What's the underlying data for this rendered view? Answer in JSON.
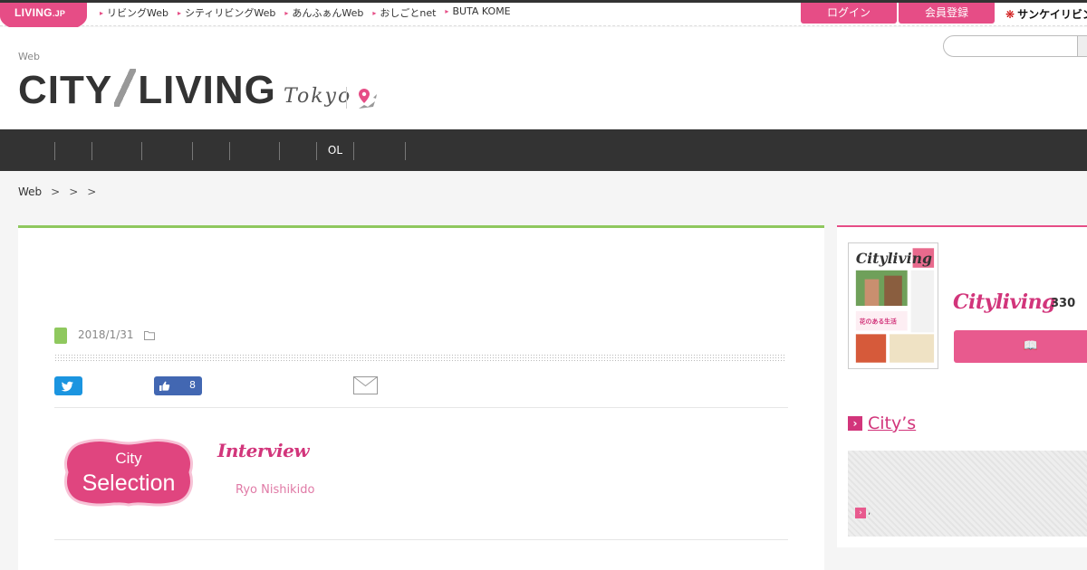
{
  "topbar": {
    "brand": "LIVING",
    "brand_suffix": ".JP",
    "links": [
      "リビングWeb",
      "シティリビングWeb",
      "あんふぁんWeb",
      "おしごとnet",
      "BUTA KOME"
    ],
    "login_label": "ログイン",
    "register_label": "会員登録",
    "sankei_label": "サンケイリビン"
  },
  "header": {
    "web_label": "Web",
    "logo_left": "CITY",
    "logo_right": "LIVING",
    "city": "Tokyo",
    "search_placeholder": ""
  },
  "nav": {
    "items": [
      "",
      "",
      "",
      "",
      "",
      "",
      "",
      "OL",
      ""
    ]
  },
  "breadcrumb": {
    "items": [
      "Web",
      ">",
      ">",
      ">"
    ]
  },
  "article": {
    "date": "2018/1/31",
    "like_count": "8",
    "badge_top": "City",
    "badge_bottom": "Selection",
    "interview": "Interview",
    "author": "Ryo Nishikido"
  },
  "sidebar": {
    "magazine_logo": "Cityliving",
    "issue_count": "330",
    "read_icon": "📖",
    "citys_title": "City’s",
    "panel_text": ","
  },
  "colors": {
    "brand_pink": "#e64d86",
    "accent_magenta": "#d2357b",
    "category_green": "#8fc85e",
    "nav_dark": "#333333",
    "twitter_blue": "#1b95e0",
    "facebook_blue": "#4267b2"
  }
}
